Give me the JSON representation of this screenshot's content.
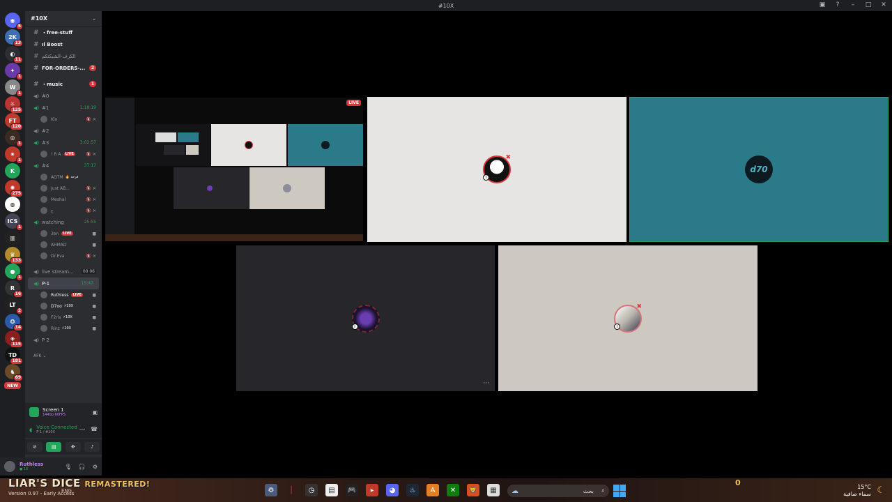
{
  "window": {
    "title": "#10X",
    "controls": [
      "▣",
      "?",
      "–",
      "□",
      "✕"
    ]
  },
  "servers": [
    {
      "label": "◉",
      "color": "#5865f2",
      "badge": "5"
    },
    {
      "label": "2K",
      "color": "#3d6fb2",
      "badge": "13"
    },
    {
      "label": "◐",
      "color": "#2d2d33",
      "badge": "11"
    },
    {
      "label": "✦",
      "color": "#6a3aa8",
      "badge": "1"
    },
    {
      "label": "W",
      "color": "#888",
      "badge": "1"
    },
    {
      "label": "☼",
      "color": "#b33",
      "badge": "125"
    },
    {
      "label": "FT",
      "color": "#c0392b",
      "badge": "120"
    },
    {
      "label": "◎",
      "color": "#3a2a22",
      "badge": "1"
    },
    {
      "label": "✷",
      "color": "#c0392b",
      "badge": "1"
    },
    {
      "label": "K",
      "color": "#23a55a",
      "badge": ""
    },
    {
      "label": "✺",
      "color": "#c0392b",
      "badge": "275"
    },
    {
      "label": "◍",
      "color": "#fff",
      "badge": ""
    },
    {
      "label": "ICS",
      "color": "#445",
      "badge": "1"
    },
    {
      "label": "▥",
      "color": "#222",
      "badge": ""
    },
    {
      "label": "♛",
      "color": "#b38b2a",
      "badge": "133"
    },
    {
      "label": "●",
      "color": "#23a55a",
      "badge": "1"
    },
    {
      "label": "R",
      "color": "#333",
      "badge": "16"
    },
    {
      "label": "LT",
      "color": "#222",
      "badge": "2"
    },
    {
      "label": "✪",
      "color": "#2d5aa8",
      "badge": "14"
    },
    {
      "label": "◈",
      "color": "#8a1f1f",
      "badge": "115"
    },
    {
      "label": "TD",
      "color": "#111",
      "badge": "181"
    },
    {
      "label": "♞",
      "color": "#6b4a2a",
      "badge": "69"
    },
    {
      "label": "NEW",
      "color": "#da373c",
      "badge": "",
      "is_new": true
    }
  ],
  "sidebar": {
    "server_name": "#10X",
    "channels_top": [
      {
        "type": "text",
        "name": "・free-stuff",
        "bold": true
      },
      {
        "type": "text",
        "name": "ıl Boost",
        "bold": true
      },
      {
        "type": "text",
        "name": "الكرف-الشبكتكم",
        "bold": false
      },
      {
        "type": "text",
        "name": "FOR-ORDERS-...",
        "bold": true,
        "badge": "2"
      },
      {
        "type": "text",
        "name": "・music",
        "bold": true,
        "badge": "1"
      }
    ],
    "voice_channels": [
      {
        "name": "#0",
        "users": []
      },
      {
        "name": "#1",
        "time": "1:18:19",
        "users": [
          {
            "name": "Klo",
            "icons": "🔇 ✕"
          }
        ]
      },
      {
        "name": "#2",
        "users": []
      },
      {
        "name": "#3",
        "time": "3:02:57",
        "users": [
          {
            "name": "! R A",
            "live": "LIVE",
            "icons": "🔇 ✕"
          }
        ]
      },
      {
        "name": "#4",
        "time": "37:17",
        "users": [
          {
            "name": "AQTM",
            "tag": "🔥 فرحة",
            "icons": ""
          },
          {
            "name": "Just AB...",
            "icons": "🔇 ✕"
          },
          {
            "name": "Meshal",
            "icons": "🔇 ✕"
          },
          {
            "name": "ع",
            "icons": "🔇 ✕"
          }
        ]
      },
      {
        "name": "watching",
        "time": "25:55",
        "users": [
          {
            "name": "3en",
            "live": "LIVE",
            "icons": "■"
          },
          {
            "name": "AHMAD",
            "icons": "■"
          },
          {
            "name": "Dr.Eva",
            "icons": "🔇 ✕"
          }
        ]
      },
      {
        "name": "live stream...",
        "count": "00  06",
        "users": []
      },
      {
        "name": "P-1",
        "time": "15:47",
        "active": true,
        "users": [
          {
            "name": "Ruthless",
            "live": "LIVE",
            "icons": "■",
            "bright": true
          },
          {
            "name": "D7oo",
            "tag": "⚡10X",
            "icons": "■",
            "bright": true
          },
          {
            "name": "F2ris",
            "tag": "⚡10X",
            "icons": "■"
          },
          {
            "name": "Rinz",
            "tag": "⚡10X",
            "icons": "■"
          }
        ]
      },
      {
        "name": "P 2",
        "users": []
      }
    ],
    "afk_label": "AFK ⌄"
  },
  "stream_panel": {
    "title": "Screen 1",
    "subtitle": "1440p 60FPS"
  },
  "voice_panel": {
    "status": "Voice Connected",
    "location": "P-1 / #10X"
  },
  "user_panel": {
    "username": "Ruthless",
    "status": "● 16"
  },
  "tiles": {
    "stream_live": "LIVE",
    "t3_avatar_text": "d70",
    "more_label": "···",
    "mute_glyph": "Ⅰ"
  },
  "taskbar": {
    "game_title": "LIAR'S DICE",
    "game_subtitle": "REMASTERED!",
    "game_version": "Version 0.97 - Early Access",
    "lang": "ENG",
    "search_text": "بحث",
    "weather_temp": "15°C",
    "weather_desc": "سماء صافية",
    "gold_value": "0"
  },
  "colors": {
    "accent_green": "#23a55a",
    "live_red": "#da373c",
    "tile_teal": "#2b7a8a"
  }
}
